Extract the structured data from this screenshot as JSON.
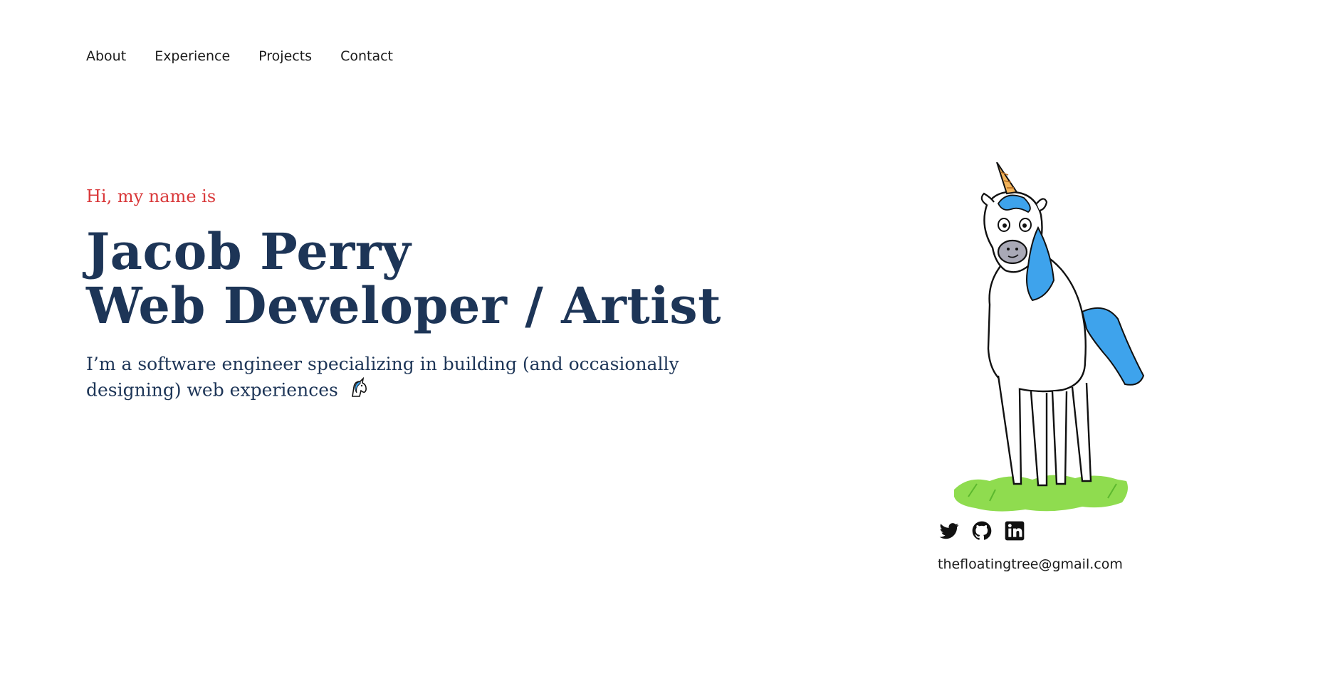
{
  "nav": {
    "items": [
      {
        "label": "About"
      },
      {
        "label": "Experience"
      },
      {
        "label": "Projects"
      },
      {
        "label": "Contact"
      }
    ]
  },
  "hero": {
    "greeting": "Hi, my name is",
    "name": "Jacob Perry",
    "role": "Web Developer / Artist",
    "intro": "I’m a software engineer specializing in building (and occasionally designing) web experiences"
  },
  "social": {
    "icons": [
      "twitter-icon",
      "github-icon",
      "linkedin-icon"
    ],
    "email": "thefloatingtree@gmail.com"
  },
  "colors": {
    "accent": "#d9383a",
    "heading": "#1d3557",
    "text": "#1a1a1a",
    "unicorn_blue": "#3ea3ec",
    "grass": "#8fdc4f"
  }
}
